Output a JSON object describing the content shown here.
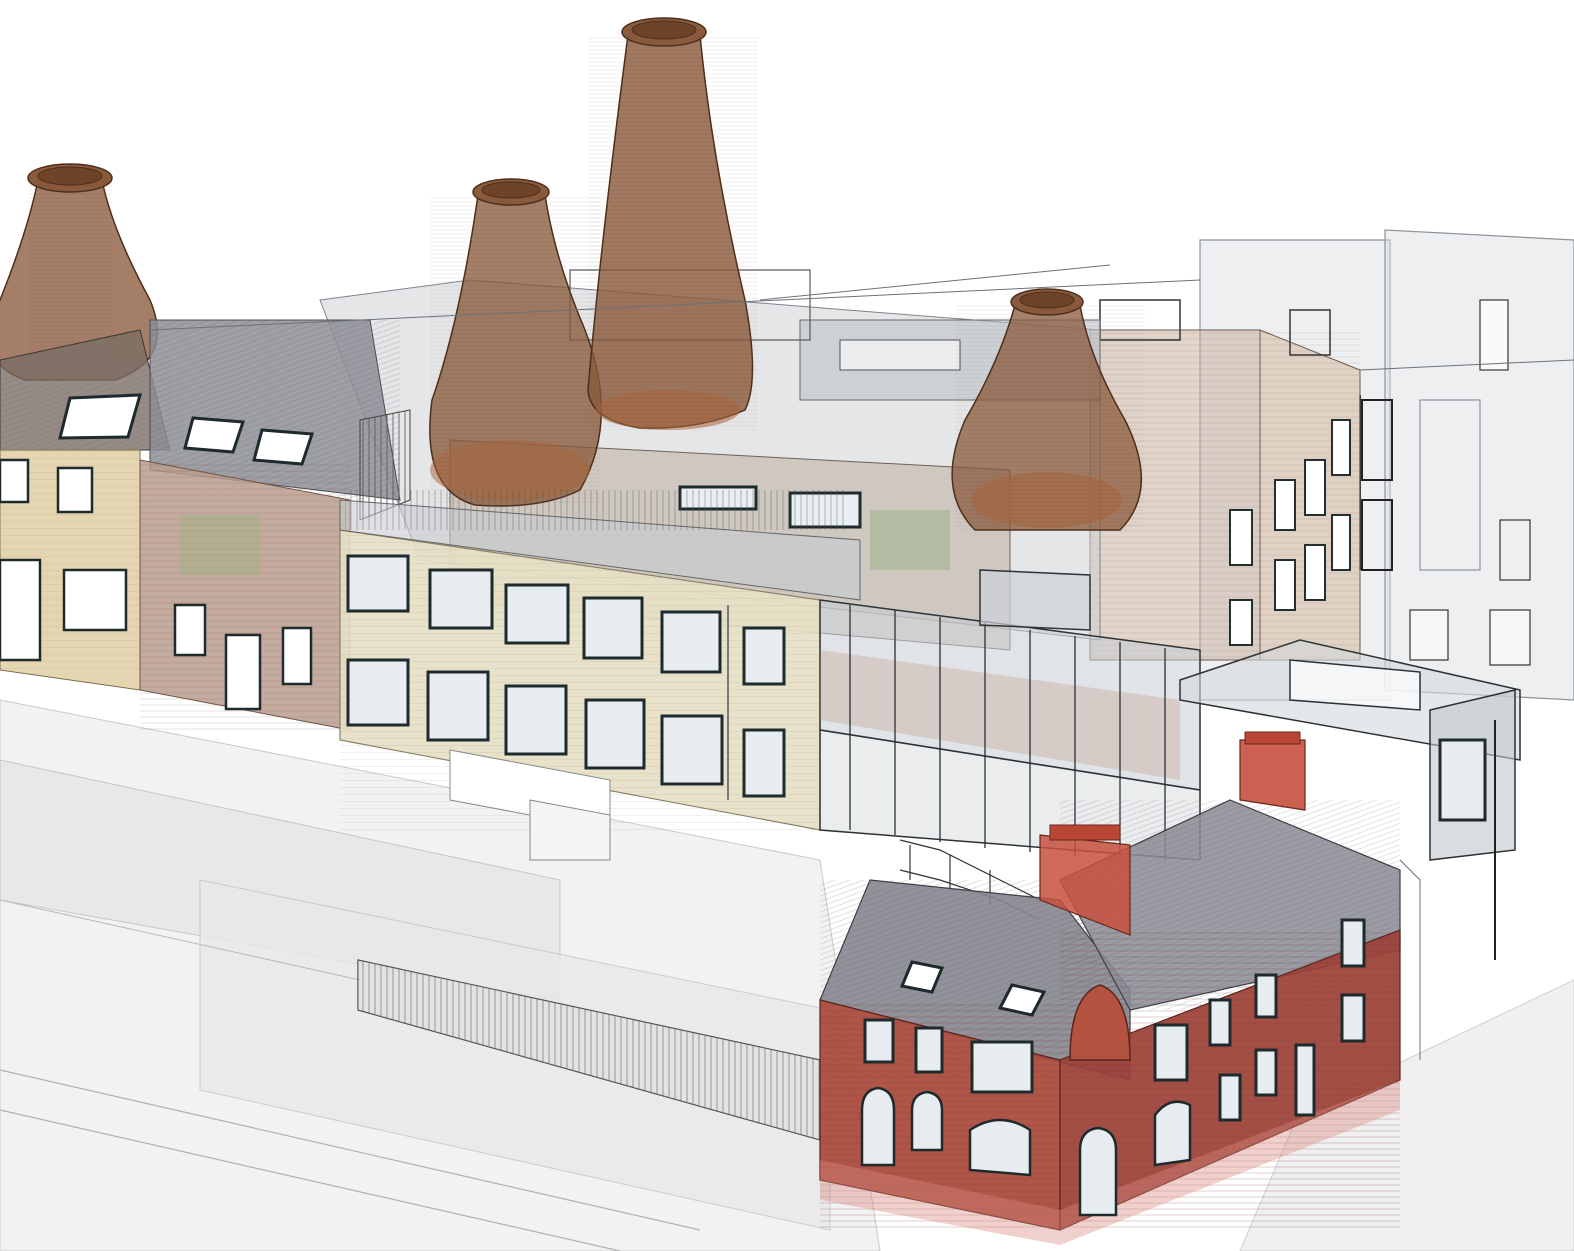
{
  "view": {
    "kind": "isometric architectural BIM model",
    "labels": []
  },
  "palette": {
    "background": "#ffffff",
    "kiln": "#8a5a3c",
    "kiln_dark": "#6e4428",
    "brick_red": "#a8483a",
    "brick_brown": "#a88a78",
    "stone_cream": "#e2dcc4",
    "slate_roof": "#8e8e96",
    "glass": "#c6ccd4",
    "window_frame": "#2e3a3e",
    "chimney_red": "#c8503e",
    "ghost_line": "#9aa0a8",
    "ground": "#e9e9ea"
  },
  "elements": {
    "kilns": [
      "kiln-left",
      "kiln-center-left",
      "kiln-tall-center",
      "kiln-right"
    ],
    "buildings": [
      "terrace-cream-left",
      "terrace-brick-left",
      "factory-cream-center",
      "glass-link",
      "brick-block-right",
      "ghost-block-far-right",
      "red-brick-corner-house"
    ]
  }
}
